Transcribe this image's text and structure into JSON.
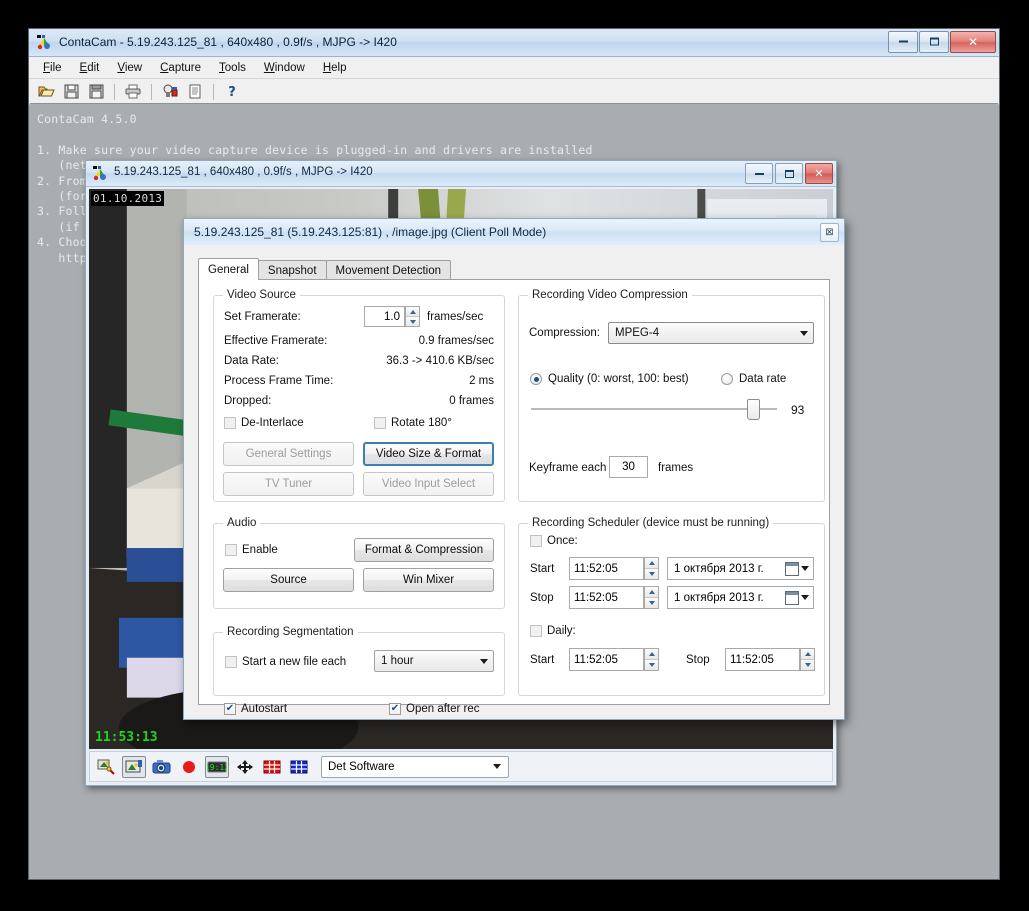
{
  "main_window": {
    "title": "ContaCam - 5.19.243.125_81 , 640x480 , 0.9f/s , MJPG -> I420",
    "icon": "contacam-icon",
    "menu": [
      "File",
      "Edit",
      "View",
      "Capture",
      "Tools",
      "Window",
      "Help"
    ],
    "toolbar_icons": [
      "open-folder-icon",
      "save-icon",
      "save-all-icon",
      "print-icon",
      "webcam-config-icon",
      "log-icon",
      "help-icon"
    ],
    "window_buttons": {
      "minimize": "minimize-button",
      "maximize": "maximize-button",
      "close": "close-button"
    },
    "client_text": "ContaCam 4.5.0\n\n1. Make sure your video capture device is plugged-in and drivers are installed\n   (net\n2. From\n   (for\n3. Follo\n   (if it\n4. Choo\n   http"
  },
  "video_window": {
    "title": "5.19.243.125_81 , 640x480 , 0.9f/s , MJPG -> I420",
    "icon": "contacam-icon",
    "overlay_date": "01.10.2013",
    "overlay_time": "11:53:13",
    "bottom_toolbar": {
      "icons": [
        "settings-wizard-icon",
        "snapshot-folder-icon",
        "camera-icon",
        "record-dot-icon",
        "display-counter-icon",
        "move-resize-icon",
        "detection-zones-red-icon",
        "detection-zones-blue-icon"
      ],
      "detector_select": "Det Software"
    },
    "window_buttons": {
      "minimize": "minimize-button",
      "maximize": "maximize-button",
      "close": "close-button"
    }
  },
  "dialog": {
    "title": "5.19.243.125_81 (5.19.243.125:81) , /image.jpg (Client Poll Mode)",
    "close_label": "⊠",
    "tabs": [
      {
        "label": "General",
        "active": true
      },
      {
        "label": "Snapshot",
        "active": false
      },
      {
        "label": "Movement Detection",
        "active": false
      }
    ],
    "video_source": {
      "caption": "Video Source",
      "set_framerate_label": "Set Framerate:",
      "set_framerate_value": "1.0",
      "set_framerate_units": "frames/sec",
      "effective_framerate_label": "Effective Framerate:",
      "effective_framerate_value": "0.9 frames/sec",
      "data_rate_label": "Data Rate:",
      "data_rate_value": "36.3 -> 410.6 KB/sec",
      "process_frame_time_label": "Process Frame Time:",
      "process_frame_time_value": "2 ms",
      "dropped_label": "Dropped:",
      "dropped_value": "0 frames",
      "deinterlace_label": "De-Interlace",
      "deinterlace_checked": false,
      "rotate_label": "Rotate 180°",
      "rotate_checked": false,
      "general_settings_btn": "General Settings",
      "general_settings_enabled": false,
      "video_size_format_btn": "Video Size & Format",
      "video_size_format_enabled": true,
      "tv_tuner_btn": "TV Tuner",
      "tv_tuner_enabled": false,
      "video_input_select_btn": "Video Input Select",
      "video_input_select_enabled": false
    },
    "audio": {
      "caption": "Audio",
      "enable_label": "Enable",
      "enable_checked": false,
      "format_compression_btn": "Format & Compression",
      "source_btn": "Source",
      "win_mixer_btn": "Win Mixer"
    },
    "segmentation": {
      "caption": "Recording Segmentation",
      "start_new_file_label": "Start a new file each",
      "start_new_file_checked": false,
      "interval_value": "1 hour"
    },
    "footer": {
      "autostart_label": "Autostart",
      "autostart_checked": true,
      "open_after_rec_label": "Open after rec",
      "open_after_rec_checked": true
    },
    "compression": {
      "caption": "Recording Video Compression",
      "compression_label": "Compression:",
      "compression_value": "MPEG-4",
      "quality_radio_label": "Quality (0: worst, 100: best)",
      "quality_selected": true,
      "datarate_radio_label": "Data rate",
      "datarate_selected": false,
      "quality_value": "93",
      "quality_percent": 93,
      "keyframe_label": "Keyframe each",
      "keyframe_value": "30",
      "keyframe_units": "frames"
    },
    "scheduler": {
      "caption": "Recording Scheduler (device must be running)",
      "once_label": "Once:",
      "once_checked": false,
      "start_label": "Start",
      "stop_label": "Stop",
      "once_start_time": "11:52:05",
      "once_start_date": "1 октября  2013 г.",
      "once_stop_time": "11:52:05",
      "once_stop_date": "1 октября  2013 г.",
      "daily_label": "Daily:",
      "daily_checked": false,
      "daily_start_label": "Start",
      "daily_start_time": "11:52:05",
      "daily_stop_label": "Stop",
      "daily_stop_time": "11:52:05"
    }
  },
  "colors": {
    "accent_blue": "#3c7fb1",
    "close_red": "#cf5b53",
    "overlay_green": "#21d421",
    "link_blue": "#7ea6ff",
    "window_gray": "#a9adb0"
  }
}
